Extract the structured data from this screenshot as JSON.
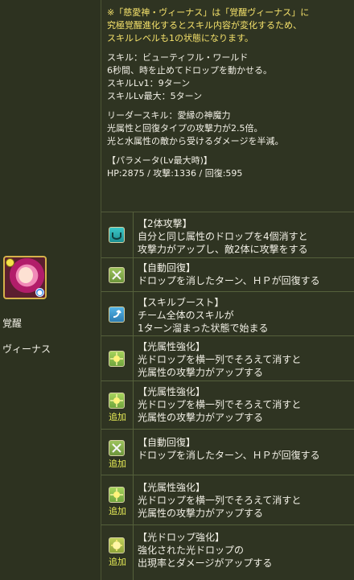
{
  "character": {
    "name_lines": [
      "覚醒",
      "ヴィーナス"
    ],
    "icon_badges": [
      "yellow-star-badge",
      "blue-a-badge"
    ]
  },
  "info": {
    "note_lines": [
      "※「慈愛神・ヴィーナス」は「覚醒ヴィーナス」に",
      "究極覚醒進化するとスキル内容が変化するため、",
      "スキルレベルも1の状態になります。"
    ],
    "skill_name": "スキル：ビューティフル・ワールド",
    "skill_desc": "6秒間、時を止めてドロップを動かせる。",
    "skill_lv1": "スキルLv1：9ターン",
    "skill_lvmax": "スキルLv最大：5ターン",
    "leader_name": "リーダースキル：愛縁の神魔力",
    "leader_desc1": "光属性と回復タイプの攻撃力が2.5倍。",
    "leader_desc2": "光と水属性の敵から受けるダメージを半減。",
    "param_title": "【パラメータ(Lv最大時)】",
    "param_values": "HP:2875 / 攻撃:1336 / 回復:595"
  },
  "awakenings": [
    {
      "title": "【2体攻撃】",
      "lines": [
        "自分と同じ属性のドロップを4個消すと",
        "攻撃力がアップし、敵2体に攻撃をする"
      ],
      "icon": "two-target-icon",
      "tag": ""
    },
    {
      "title": "【自動回復】",
      "lines": [
        "ドロップを消したターン、ＨＰが回復する"
      ],
      "icon": "auto-heal-icon",
      "tag": ""
    },
    {
      "title": "【スキルブースト】",
      "lines": [
        "チーム全体のスキルが",
        "1ターン溜まった状態で始まる"
      ],
      "icon": "skill-boost-icon",
      "tag": ""
    },
    {
      "title": "【光属性強化】",
      "lines": [
        "光ドロップを横一列でそろえて消すと",
        "光属性の攻撃力がアップする"
      ],
      "icon": "light-row-icon",
      "tag": ""
    },
    {
      "title": "【光属性強化】",
      "lines": [
        "光ドロップを横一列でそろえて消すと",
        "光属性の攻撃力がアップする"
      ],
      "icon": "light-row-icon",
      "tag": "追加"
    },
    {
      "title": "【自動回復】",
      "lines": [
        "ドロップを消したターン、ＨＰが回復する"
      ],
      "icon": "auto-heal-icon",
      "tag": "追加"
    },
    {
      "title": "【光属性強化】",
      "lines": [
        "光ドロップを横一列でそろえて消すと",
        "光属性の攻撃力がアップする"
      ],
      "icon": "light-row-icon",
      "tag": "追加"
    },
    {
      "title": "【光ドロップ強化】",
      "lines": [
        "強化された光ドロップの",
        "出現率とダメージがアップする"
      ],
      "icon": "light-drop-enhance-icon",
      "tag": "追加"
    }
  ]
}
